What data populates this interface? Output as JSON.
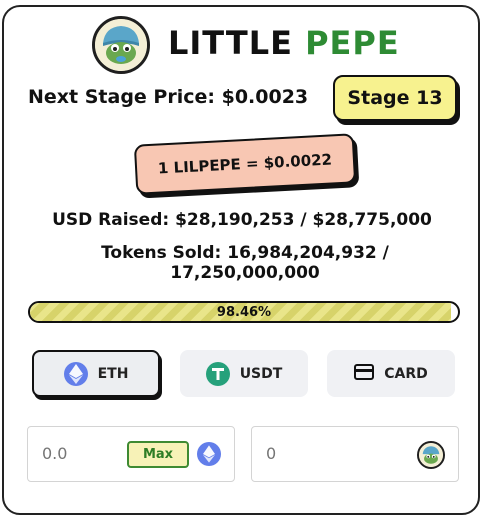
{
  "header": {
    "title_part1": "LITTLE",
    "title_part2": "PEPE",
    "logo_icon": "pepe-logo-icon"
  },
  "presale": {
    "next_stage_price": "Next Stage Price: $0.0023",
    "stage": "Stage 13",
    "rate": "1 LILPEPE = $0.0022",
    "usd_raised": "USD Raised: $28,190,253 / $28,775,000",
    "tokens_sold": "Tokens Sold: 16,984,204,932 / 17,250,000,000",
    "progress_label": "98.46%",
    "progress_value": 98.46
  },
  "payment_methods": [
    {
      "label": "ETH",
      "icon": "eth-icon",
      "selected": true
    },
    {
      "label": "USDT",
      "icon": "usdt-icon",
      "selected": false
    },
    {
      "label": "CARD",
      "icon": "card-icon",
      "selected": false
    }
  ],
  "inputs": {
    "pay_placeholder": "0.0",
    "max_label": "Max",
    "receive_value": "0"
  },
  "colors": {
    "accent_green": "#2e8b34",
    "stage_yellow": "#f7f28f",
    "rate_pink": "#f8c7b3",
    "eth_blue": "#627eea",
    "usdt_green": "#26a17b"
  }
}
